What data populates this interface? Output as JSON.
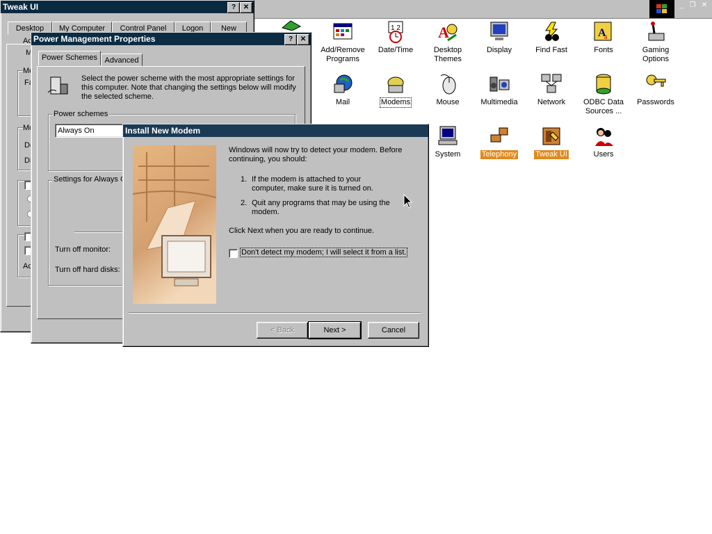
{
  "colors": {
    "desktop_bg": "#ffffff",
    "face": "#c0c0c0",
    "active_title": "#0a246a",
    "wizard_title": "#1b3a55",
    "selection": "#e08a1e"
  },
  "tweak_ui": {
    "title": "Tweak UI",
    "tabs": [
      "Desktop",
      "My Computer",
      "Control Panel",
      "Logon",
      "New"
    ],
    "partial_labels": [
      "Ac",
      "M",
      "Mo",
      "Fa",
      "Mo",
      "De",
      "Dr",
      "Ac"
    ]
  },
  "power_mgmt": {
    "title": "Power Management Properties",
    "tabs": [
      "Power Schemes",
      "Advanced"
    ],
    "description": "Select the power scheme with the most appropriate settings for this computer. Note that changing the settings below will modify the selected scheme.",
    "schemes_group_label": "Power schemes",
    "scheme_value": "Always On",
    "settings_group_label": "Settings for Always O",
    "turn_off_monitor": "Turn off monitor:",
    "turn_off_disks": "Turn off hard disks:"
  },
  "modem_wizard": {
    "title": "Install New Modem",
    "intro": "Windows will now try to detect your modem.  Before continuing, you should:",
    "step1_num": "1.",
    "step1": "If the modem is attached to your computer, make sure it is turned on.",
    "step2_num": "2.",
    "step2": "Quit any programs that may be using the modem.",
    "click_next": "Click Next when you are ready to continue.",
    "checkbox_label": "Don't detect my modem; I will select it from a list.",
    "back_label": "< Back",
    "next_label": "Next >",
    "cancel_label": "Cancel"
  },
  "control_panel": {
    "icons": [
      {
        "label": "Add/Remove Programs",
        "icon": "add-remove-programs-icon"
      },
      {
        "label": "Date/Time",
        "icon": "date-time-icon"
      },
      {
        "label": "Desktop Themes",
        "icon": "desktop-themes-icon"
      },
      {
        "label": "Display",
        "icon": "display-icon"
      },
      {
        "label": "Find Fast",
        "icon": "find-fast-icon"
      },
      {
        "label": "Fonts",
        "icon": "fonts-icon"
      },
      {
        "label": "Gaming Options",
        "icon": "gaming-options-icon"
      },
      {
        "label": "Mail",
        "icon": "mail-icon"
      },
      {
        "label": "Modems",
        "icon": "modems-icon"
      },
      {
        "label": "Mouse",
        "icon": "mouse-icon"
      },
      {
        "label": "Multimedia",
        "icon": "multimedia-icon"
      },
      {
        "label": "Network",
        "icon": "network-icon"
      },
      {
        "label": "ODBC Data Sources ...",
        "icon": "odbc-icon"
      },
      {
        "label": "Passwords",
        "icon": "passwords-icon"
      },
      {
        "label": "System",
        "icon": "system-icon"
      },
      {
        "label": "Telephony",
        "icon": "telephony-icon"
      },
      {
        "label": "Tweak UI",
        "icon": "tweak-ui-icon"
      },
      {
        "label": "Users",
        "icon": "users-icon"
      }
    ]
  },
  "titlebar_buttons": {
    "help": "?",
    "close": "✕",
    "minimize": "_",
    "restore": "❐"
  }
}
